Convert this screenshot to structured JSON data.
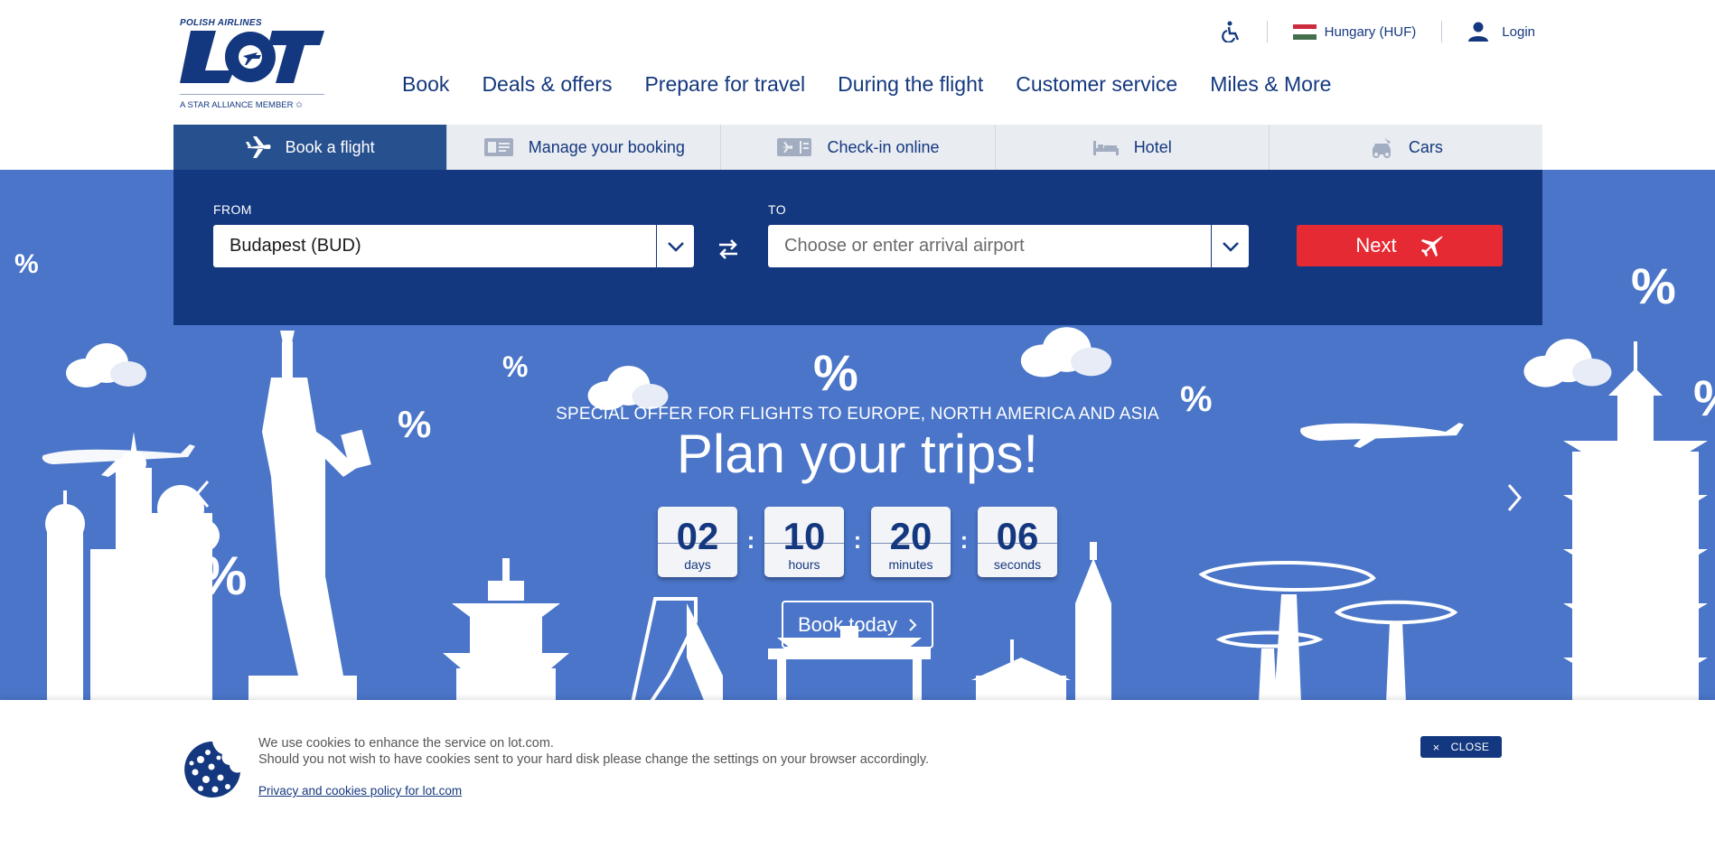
{
  "brand": {
    "airline_tagline": "POLISH AIRLINES",
    "logo_text": "LOT",
    "alliance": "A STAR ALLIANCE MEMBER"
  },
  "utility": {
    "accessibility_icon": "wheelchair-icon",
    "region": "Hungary (HUF)",
    "login": "Login"
  },
  "main_nav": [
    "Book",
    "Deals & offers",
    "Prepare for travel",
    "During the flight",
    "Customer service",
    "Miles & More"
  ],
  "tabs": [
    {
      "label": "Book a flight",
      "icon": "plane-icon",
      "active": true
    },
    {
      "label": "Manage your booking",
      "icon": "ticket-icon",
      "active": false
    },
    {
      "label": "Check-in online",
      "icon": "boarding-pass-icon",
      "active": false
    },
    {
      "label": "Hotel",
      "icon": "bed-icon",
      "active": false
    },
    {
      "label": "Cars",
      "icon": "car-icon",
      "active": false
    }
  ],
  "search": {
    "from_label": "FROM",
    "from_value": "Budapest (BUD)",
    "to_label": "TO",
    "to_placeholder": "Choose or enter arrival airport",
    "next_label": "Next"
  },
  "promo": {
    "subtitle": "SPECIAL OFFER FOR FLIGHTS TO EUROPE, NORTH AMERICA AND ASIA",
    "title": "Plan your trips!",
    "countdown": [
      {
        "value": "02",
        "unit": "days"
      },
      {
        "value": "10",
        "unit": "hours"
      },
      {
        "value": "20",
        "unit": "minutes"
      },
      {
        "value": "06",
        "unit": "seconds"
      }
    ],
    "cta": "Book today",
    "percent_sign": "%"
  },
  "cookie": {
    "line1": "We use cookies to enhance the service on lot.com.",
    "line2": "Should you not wish to have cookies sent to your hard disk please change the settings on your browser accordingly.",
    "link": "Privacy and cookies policy for lot.com",
    "close": "CLOSE",
    "close_glyph": "×"
  },
  "colors": {
    "brand_navy": "#14387f",
    "hero_blue": "#4a75c8",
    "active_tab": "#27508f",
    "next_red": "#e52a33"
  }
}
